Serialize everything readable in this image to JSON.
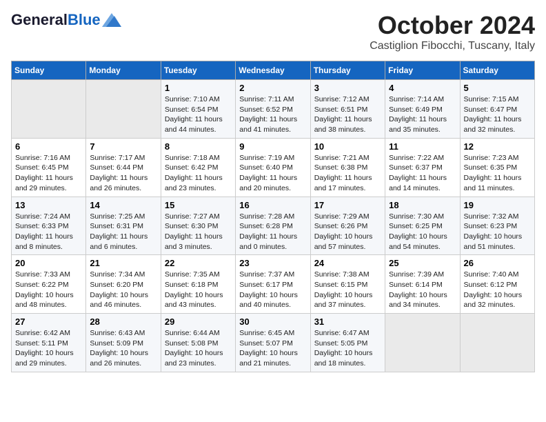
{
  "header": {
    "logo_general": "General",
    "logo_blue": "Blue",
    "month": "October 2024",
    "location": "Castiglion Fibocchi, Tuscany, Italy"
  },
  "days_of_week": [
    "Sunday",
    "Monday",
    "Tuesday",
    "Wednesday",
    "Thursday",
    "Friday",
    "Saturday"
  ],
  "weeks": [
    [
      {
        "day": null
      },
      {
        "day": null
      },
      {
        "day": "1",
        "sunrise": "Sunrise: 7:10 AM",
        "sunset": "Sunset: 6:54 PM",
        "daylight": "Daylight: 11 hours and 44 minutes."
      },
      {
        "day": "2",
        "sunrise": "Sunrise: 7:11 AM",
        "sunset": "Sunset: 6:52 PM",
        "daylight": "Daylight: 11 hours and 41 minutes."
      },
      {
        "day": "3",
        "sunrise": "Sunrise: 7:12 AM",
        "sunset": "Sunset: 6:51 PM",
        "daylight": "Daylight: 11 hours and 38 minutes."
      },
      {
        "day": "4",
        "sunrise": "Sunrise: 7:14 AM",
        "sunset": "Sunset: 6:49 PM",
        "daylight": "Daylight: 11 hours and 35 minutes."
      },
      {
        "day": "5",
        "sunrise": "Sunrise: 7:15 AM",
        "sunset": "Sunset: 6:47 PM",
        "daylight": "Daylight: 11 hours and 32 minutes."
      }
    ],
    [
      {
        "day": "6",
        "sunrise": "Sunrise: 7:16 AM",
        "sunset": "Sunset: 6:45 PM",
        "daylight": "Daylight: 11 hours and 29 minutes."
      },
      {
        "day": "7",
        "sunrise": "Sunrise: 7:17 AM",
        "sunset": "Sunset: 6:44 PM",
        "daylight": "Daylight: 11 hours and 26 minutes."
      },
      {
        "day": "8",
        "sunrise": "Sunrise: 7:18 AM",
        "sunset": "Sunset: 6:42 PM",
        "daylight": "Daylight: 11 hours and 23 minutes."
      },
      {
        "day": "9",
        "sunrise": "Sunrise: 7:19 AM",
        "sunset": "Sunset: 6:40 PM",
        "daylight": "Daylight: 11 hours and 20 minutes."
      },
      {
        "day": "10",
        "sunrise": "Sunrise: 7:21 AM",
        "sunset": "Sunset: 6:38 PM",
        "daylight": "Daylight: 11 hours and 17 minutes."
      },
      {
        "day": "11",
        "sunrise": "Sunrise: 7:22 AM",
        "sunset": "Sunset: 6:37 PM",
        "daylight": "Daylight: 11 hours and 14 minutes."
      },
      {
        "day": "12",
        "sunrise": "Sunrise: 7:23 AM",
        "sunset": "Sunset: 6:35 PM",
        "daylight": "Daylight: 11 hours and 11 minutes."
      }
    ],
    [
      {
        "day": "13",
        "sunrise": "Sunrise: 7:24 AM",
        "sunset": "Sunset: 6:33 PM",
        "daylight": "Daylight: 11 hours and 8 minutes."
      },
      {
        "day": "14",
        "sunrise": "Sunrise: 7:25 AM",
        "sunset": "Sunset: 6:31 PM",
        "daylight": "Daylight: 11 hours and 6 minutes."
      },
      {
        "day": "15",
        "sunrise": "Sunrise: 7:27 AM",
        "sunset": "Sunset: 6:30 PM",
        "daylight": "Daylight: 11 hours and 3 minutes."
      },
      {
        "day": "16",
        "sunrise": "Sunrise: 7:28 AM",
        "sunset": "Sunset: 6:28 PM",
        "daylight": "Daylight: 11 hours and 0 minutes."
      },
      {
        "day": "17",
        "sunrise": "Sunrise: 7:29 AM",
        "sunset": "Sunset: 6:26 PM",
        "daylight": "Daylight: 10 hours and 57 minutes."
      },
      {
        "day": "18",
        "sunrise": "Sunrise: 7:30 AM",
        "sunset": "Sunset: 6:25 PM",
        "daylight": "Daylight: 10 hours and 54 minutes."
      },
      {
        "day": "19",
        "sunrise": "Sunrise: 7:32 AM",
        "sunset": "Sunset: 6:23 PM",
        "daylight": "Daylight: 10 hours and 51 minutes."
      }
    ],
    [
      {
        "day": "20",
        "sunrise": "Sunrise: 7:33 AM",
        "sunset": "Sunset: 6:22 PM",
        "daylight": "Daylight: 10 hours and 48 minutes."
      },
      {
        "day": "21",
        "sunrise": "Sunrise: 7:34 AM",
        "sunset": "Sunset: 6:20 PM",
        "daylight": "Daylight: 10 hours and 46 minutes."
      },
      {
        "day": "22",
        "sunrise": "Sunrise: 7:35 AM",
        "sunset": "Sunset: 6:18 PM",
        "daylight": "Daylight: 10 hours and 43 minutes."
      },
      {
        "day": "23",
        "sunrise": "Sunrise: 7:37 AM",
        "sunset": "Sunset: 6:17 PM",
        "daylight": "Daylight: 10 hours and 40 minutes."
      },
      {
        "day": "24",
        "sunrise": "Sunrise: 7:38 AM",
        "sunset": "Sunset: 6:15 PM",
        "daylight": "Daylight: 10 hours and 37 minutes."
      },
      {
        "day": "25",
        "sunrise": "Sunrise: 7:39 AM",
        "sunset": "Sunset: 6:14 PM",
        "daylight": "Daylight: 10 hours and 34 minutes."
      },
      {
        "day": "26",
        "sunrise": "Sunrise: 7:40 AM",
        "sunset": "Sunset: 6:12 PM",
        "daylight": "Daylight: 10 hours and 32 minutes."
      }
    ],
    [
      {
        "day": "27",
        "sunrise": "Sunrise: 6:42 AM",
        "sunset": "Sunset: 5:11 PM",
        "daylight": "Daylight: 10 hours and 29 minutes."
      },
      {
        "day": "28",
        "sunrise": "Sunrise: 6:43 AM",
        "sunset": "Sunset: 5:09 PM",
        "daylight": "Daylight: 10 hours and 26 minutes."
      },
      {
        "day": "29",
        "sunrise": "Sunrise: 6:44 AM",
        "sunset": "Sunset: 5:08 PM",
        "daylight": "Daylight: 10 hours and 23 minutes."
      },
      {
        "day": "30",
        "sunrise": "Sunrise: 6:45 AM",
        "sunset": "Sunset: 5:07 PM",
        "daylight": "Daylight: 10 hours and 21 minutes."
      },
      {
        "day": "31",
        "sunrise": "Sunrise: 6:47 AM",
        "sunset": "Sunset: 5:05 PM",
        "daylight": "Daylight: 10 hours and 18 minutes."
      },
      {
        "day": null
      },
      {
        "day": null
      }
    ]
  ]
}
